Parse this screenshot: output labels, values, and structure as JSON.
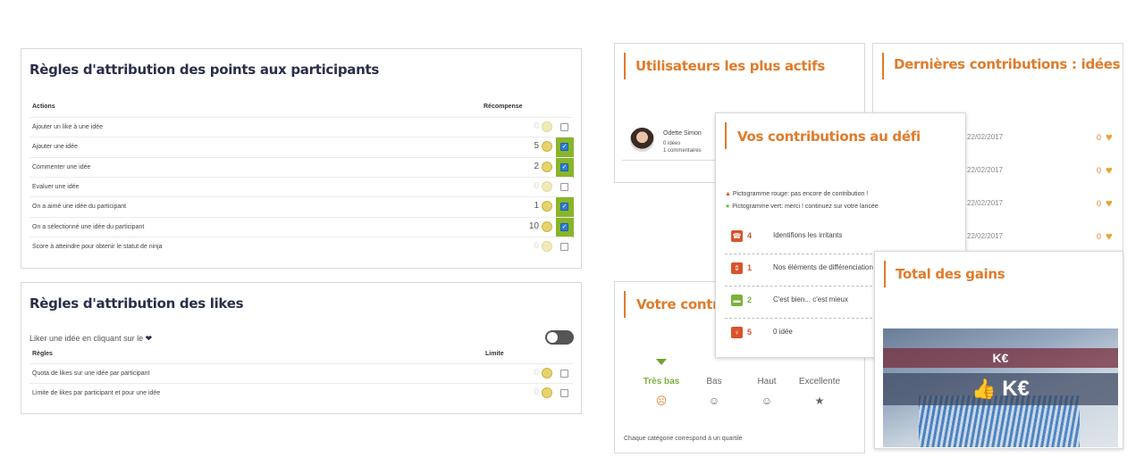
{
  "points_rules": {
    "title": "Règles d'attribution des points aux participants",
    "col_actions": "Actions",
    "col_reward": "Récompense",
    "rows": [
      {
        "label": "Ajouter un like à une idée",
        "points": "0",
        "checked": false
      },
      {
        "label": "Ajouter une idée",
        "points": "5",
        "checked": true
      },
      {
        "label": "Commenter une idée",
        "points": "2",
        "checked": true
      },
      {
        "label": "Evaluer une idée",
        "points": "0",
        "checked": false
      },
      {
        "label": "On a aimé une idée du participant",
        "points": "1",
        "checked": true
      },
      {
        "label": "On a sélectionné une idée du participant",
        "points": "10",
        "checked": true
      },
      {
        "label": "Score à atteindre pour obtenir le statut de ninja",
        "points": "0",
        "checked": false
      }
    ]
  },
  "likes_rules": {
    "title": "Règles d'attribution des likes",
    "toggle_label": "Liker une idée en cliquant sur le",
    "col_rules": "Règles",
    "col_limit": "Limite",
    "rows": [
      {
        "label": "Quota de likes sur une idée par participant",
        "points": "0"
      },
      {
        "label": "Limite de likes par participant et pour une idée",
        "points": "0"
      }
    ]
  },
  "active_users": {
    "title": "Utilisateurs les plus actifs",
    "user_name": "Odette Simon",
    "ideas": "0 idées",
    "comments": "1 commentaires"
  },
  "latest": {
    "title": "Dernières contributions : idées",
    "items": [
      {
        "date": "22/02/2017",
        "likes": "0"
      },
      {
        "date": "22/02/2017",
        "likes": "0"
      },
      {
        "date": "22/02/2017",
        "likes": "0"
      },
      {
        "date": "22/02/2017",
        "likes": "0"
      }
    ]
  },
  "challenge": {
    "title": "Vos contributions au défi",
    "legend_red": "Pictogramme rouge: pas encore de contribution !",
    "legend_green": "Pictogramme vert: merci ! continuez sur votre lancée",
    "items": [
      {
        "count": "4",
        "label": "Identifions les irritants",
        "color": "#d9532b"
      },
      {
        "count": "1",
        "label": "Nos éléments de différenciation",
        "color": "#d9532b"
      },
      {
        "count": "2",
        "label": "C'est bien... c'est mieux",
        "color": "#7ab23a"
      },
      {
        "count": "5",
        "label": "0 idée",
        "color": "#d9532b"
      }
    ]
  },
  "contribution": {
    "title": "Votre contrib",
    "levels": [
      "Très bas",
      "Bas",
      "Haut",
      "Excellente"
    ],
    "footer": "Chaque catégorie correspond à un quartile"
  },
  "gains": {
    "title": "Total des gains",
    "banner_top": "K€",
    "banner_main": "K€"
  },
  "colors": {
    "accent": "#e07b2a",
    "navy": "#2a2f4a",
    "green": "#8ab52a"
  }
}
